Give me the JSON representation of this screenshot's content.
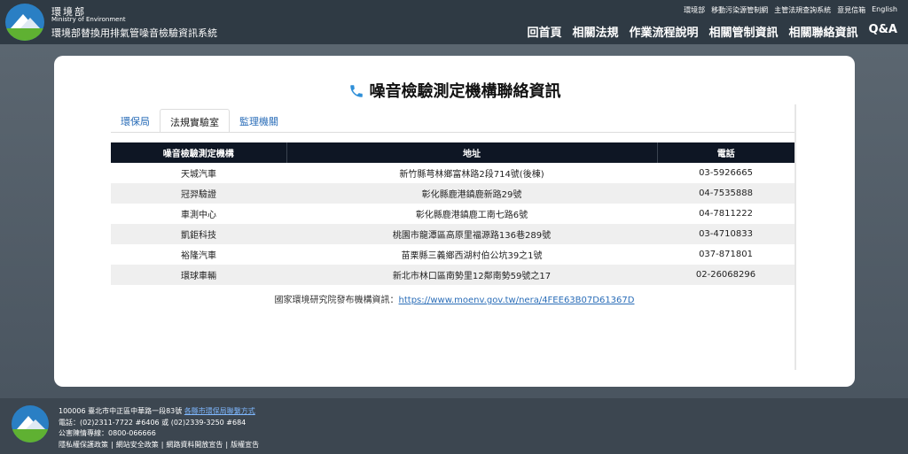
{
  "header": {
    "org_zh": "環境部",
    "org_en": "Ministry of Environment",
    "system_name": "環境部替換用排氣管噪音檢驗資訊系統",
    "top_links": [
      "環境部",
      "移動污染源管制網",
      "主管法規查詢系統",
      "意見信箱",
      "English"
    ],
    "main_nav": [
      "回首頁",
      "相關法規",
      "作業流程說明",
      "相關管制資訊",
      "相關聯絡資訊",
      "Q&A"
    ]
  },
  "card": {
    "title": "噪音檢驗測定機構聯絡資訊",
    "tabs": [
      {
        "label": "環保局",
        "active": false
      },
      {
        "label": "法規實驗室",
        "active": true
      },
      {
        "label": "監理機關",
        "active": false
      }
    ],
    "table": {
      "headers": [
        "噪音檢驗測定機構",
        "地址",
        "電話"
      ],
      "rows": [
        [
          "天城汽車",
          "新竹縣芎林鄉富林路2段714號(後棟)",
          "03-5926665"
        ],
        [
          "冠羿驗證",
          "彰化縣鹿港鎮鹿新路29號",
          "04-7535888"
        ],
        [
          "車測中心",
          "彰化縣鹿港鎮鹿工南七路6號",
          "04-7811222"
        ],
        [
          "凱鉅科技",
          "桃園市龍潭區高原里福源路136巷289號",
          "03-4710833"
        ],
        [
          "裕隆汽車",
          "苗栗縣三義鄉西湖村伯公坑39之1號",
          "037-871801"
        ],
        [
          "環球車輛",
          "新北市林口區南勢里12鄰南勢59號之17",
          "02-26068296"
        ]
      ]
    },
    "source_label": "國家環境研究院發布機構資訊：",
    "source_link": "https://www.moenv.gov.tw/nera/4FEE63B07D61367D"
  },
  "footer": {
    "address": "100006 臺北市中正區中華路一段83號",
    "address_link": "各縣市環保局聯繫方式",
    "phone": "電話：(02)2311-7722 #6406 或 (02)2339-3250 #684",
    "hotline": "公害陳情專線：0800-066666",
    "links": [
      "隱私權保護政策",
      "網站安全政策",
      "網路資料開放宣告",
      "版權宣告"
    ]
  },
  "colors": {
    "header_bg": "#2f3a44",
    "table_header_bg": "#0e1624",
    "link": "#2a6db8",
    "phone_icon": "#2f8fd8"
  },
  "icons": {
    "title_icon": "phone-icon",
    "logo": "moenv-logo"
  }
}
